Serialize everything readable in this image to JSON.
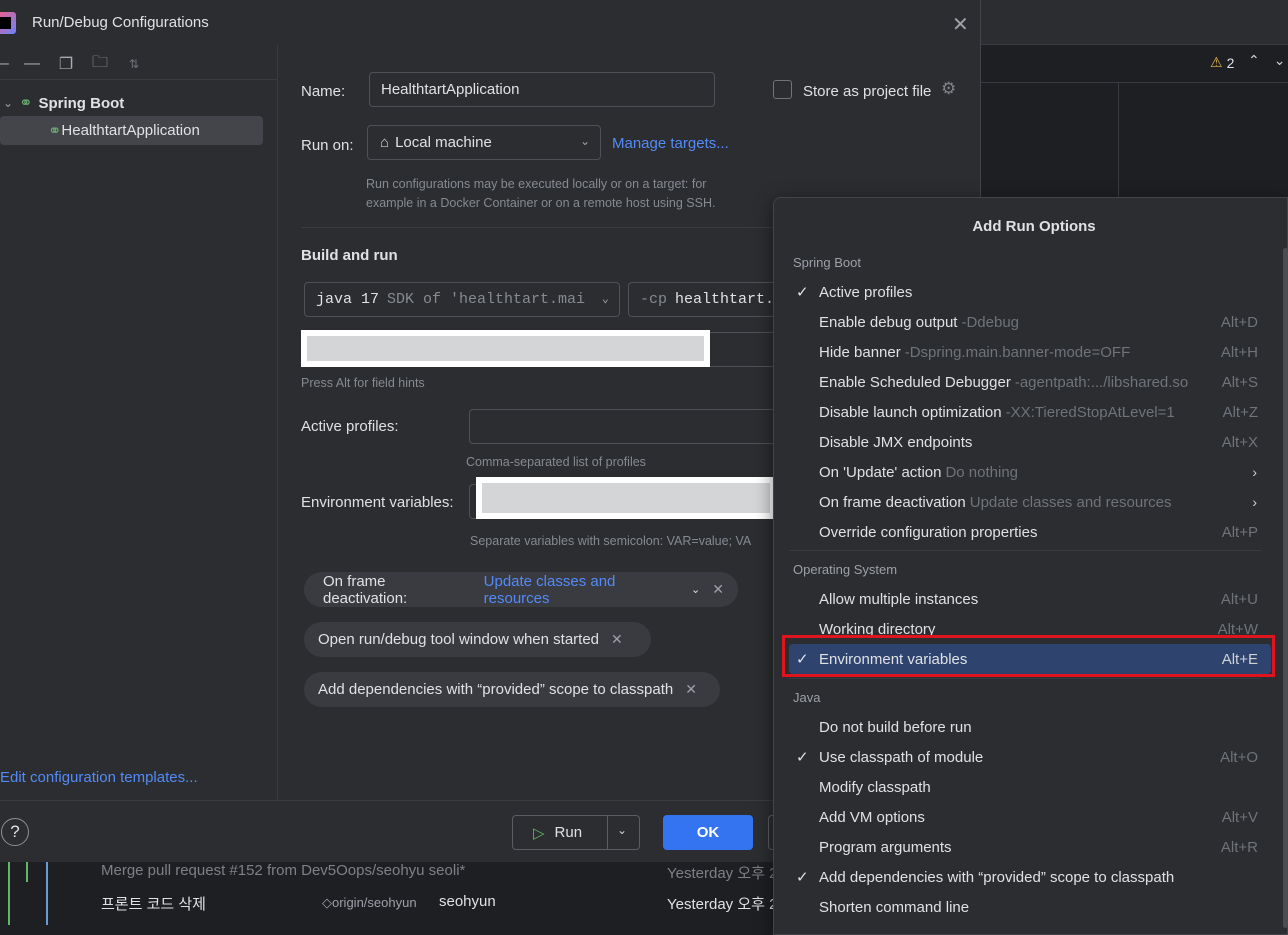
{
  "window": {
    "title": "Run/Debug Configurations"
  },
  "ide": {
    "warnings_count": "2"
  },
  "left_panel": {
    "group_label": "Spring Boot",
    "item_label": "HealthtartApplication",
    "edit_templates": "Edit configuration templates..."
  },
  "form": {
    "name_label": "Name:",
    "name_value": "HealthtartApplication",
    "store_label": "Store as project file",
    "run_on_label": "Run on:",
    "run_on_value": "Local machine",
    "manage_targets": "Manage targets...",
    "run_on_hint_1": "Run configurations may be executed locally or on a target: for",
    "run_on_hint_2": "example in a Docker Container or on a remote host using SSH.",
    "build_run_title": "Build and run",
    "jdk_main": "java 17",
    "jdk_hint": "SDK of 'healthtart.mai",
    "cp_prefix": "-cp",
    "cp_value": "healthtart.",
    "field_hint": "Press Alt for field hints",
    "active_profiles_label": "Active profiles:",
    "active_profiles_hint": "Comma-separated list of profiles",
    "env_label": "Environment variables:",
    "env_hint": "Separate variables with semicolon: VAR=value; VA"
  },
  "chips": [
    {
      "label": "On frame deactivation:",
      "value": "Update classes and resources"
    },
    {
      "label": "Open run/debug tool window when started"
    },
    {
      "label": "Add dependencies with “provided” scope to classpath"
    }
  ],
  "buttons": {
    "run": "Run",
    "ok": "OK",
    "help": "?"
  },
  "git": {
    "row1_text": "Merge pull request #152 from Dev5Oops/seohyu seoli*",
    "row1_date": "Yesterday 오후 2",
    "row2_text": "프론트 코드 삭제",
    "row2_tag": "origin/seohyun",
    "row2_author": "seohyun",
    "row2_date": "Yesterday 오후 2"
  },
  "popup": {
    "title": "Add Run Options",
    "groups": [
      {
        "title": "Spring Boot",
        "options": [
          {
            "name": "Active profiles",
            "hint": "",
            "key": "",
            "checked": true
          },
          {
            "name": "Enable debug output",
            "hint": "-Ddebug",
            "key": "Alt+D",
            "checked": false
          },
          {
            "name": "Hide banner",
            "hint": "-Dspring.main.banner-mode=OFF",
            "key": "Alt+H",
            "checked": false
          },
          {
            "name": "Enable Scheduled Debugger",
            "hint": "-agentpath:.../libshared.so",
            "key": "Alt+S",
            "checked": false
          },
          {
            "name": "Disable launch optimization",
            "hint": "-XX:TieredStopAtLevel=1",
            "key": "Alt+Z",
            "checked": false
          },
          {
            "name": "Disable JMX endpoints",
            "hint": "",
            "key": "Alt+X",
            "checked": false
          },
          {
            "name": "On 'Update' action",
            "hint": "Do nothing",
            "key": "",
            "checked": false,
            "submenu": true
          },
          {
            "name": "On frame deactivation",
            "hint": "Update classes and resources",
            "key": "",
            "checked": false,
            "submenu": true
          },
          {
            "name": "Override configuration properties",
            "hint": "",
            "key": "Alt+P",
            "checked": false
          }
        ]
      },
      {
        "title": "Operating System",
        "options": [
          {
            "name": "Allow multiple instances",
            "hint": "",
            "key": "Alt+U",
            "checked": false
          },
          {
            "name": "Working directory",
            "hint": "",
            "key": "Alt+W",
            "checked": false
          },
          {
            "name": "Environment variables",
            "hint": "",
            "key": "Alt+E",
            "checked": true,
            "selected": true
          }
        ]
      },
      {
        "title": "Java",
        "options": [
          {
            "name": "Do not build before run",
            "hint": "",
            "key": "",
            "checked": false
          },
          {
            "name": "Use classpath of module",
            "hint": "",
            "key": "Alt+O",
            "checked": true
          },
          {
            "name": "Modify classpath",
            "hint": "",
            "key": "",
            "checked": false
          },
          {
            "name": "Add VM options",
            "hint": "",
            "key": "Alt+V",
            "checked": false
          },
          {
            "name": "Program arguments",
            "hint": "",
            "key": "Alt+R",
            "checked": false
          },
          {
            "name": "Add dependencies with “provided” scope to classpath",
            "hint": "",
            "key": "",
            "checked": true
          },
          {
            "name": "Shorten command line",
            "hint": "",
            "key": "",
            "checked": false
          }
        ]
      }
    ]
  }
}
